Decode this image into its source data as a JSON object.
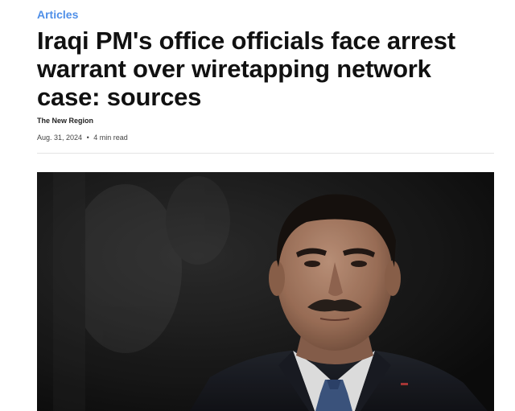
{
  "article": {
    "category": "Articles",
    "title": "Iraqi PM's office officials face arrest warrant over wiretapping network case: sources",
    "source": "The New Region",
    "date": "Aug. 31, 2024",
    "separator": "•",
    "read_time": "4 min read"
  },
  "hero_image": {
    "subject": "portrait of a man in a dark suit and blue tie against a dark background",
    "accent_colors": {
      "background": "#141414",
      "suit": "#1a1c22",
      "tie": "#3f5a86",
      "shirt": "#f2f2f2"
    }
  },
  "colors": {
    "category_link": "#4f8fe8",
    "headline": "#111111",
    "divider": "#e4e4e4"
  }
}
